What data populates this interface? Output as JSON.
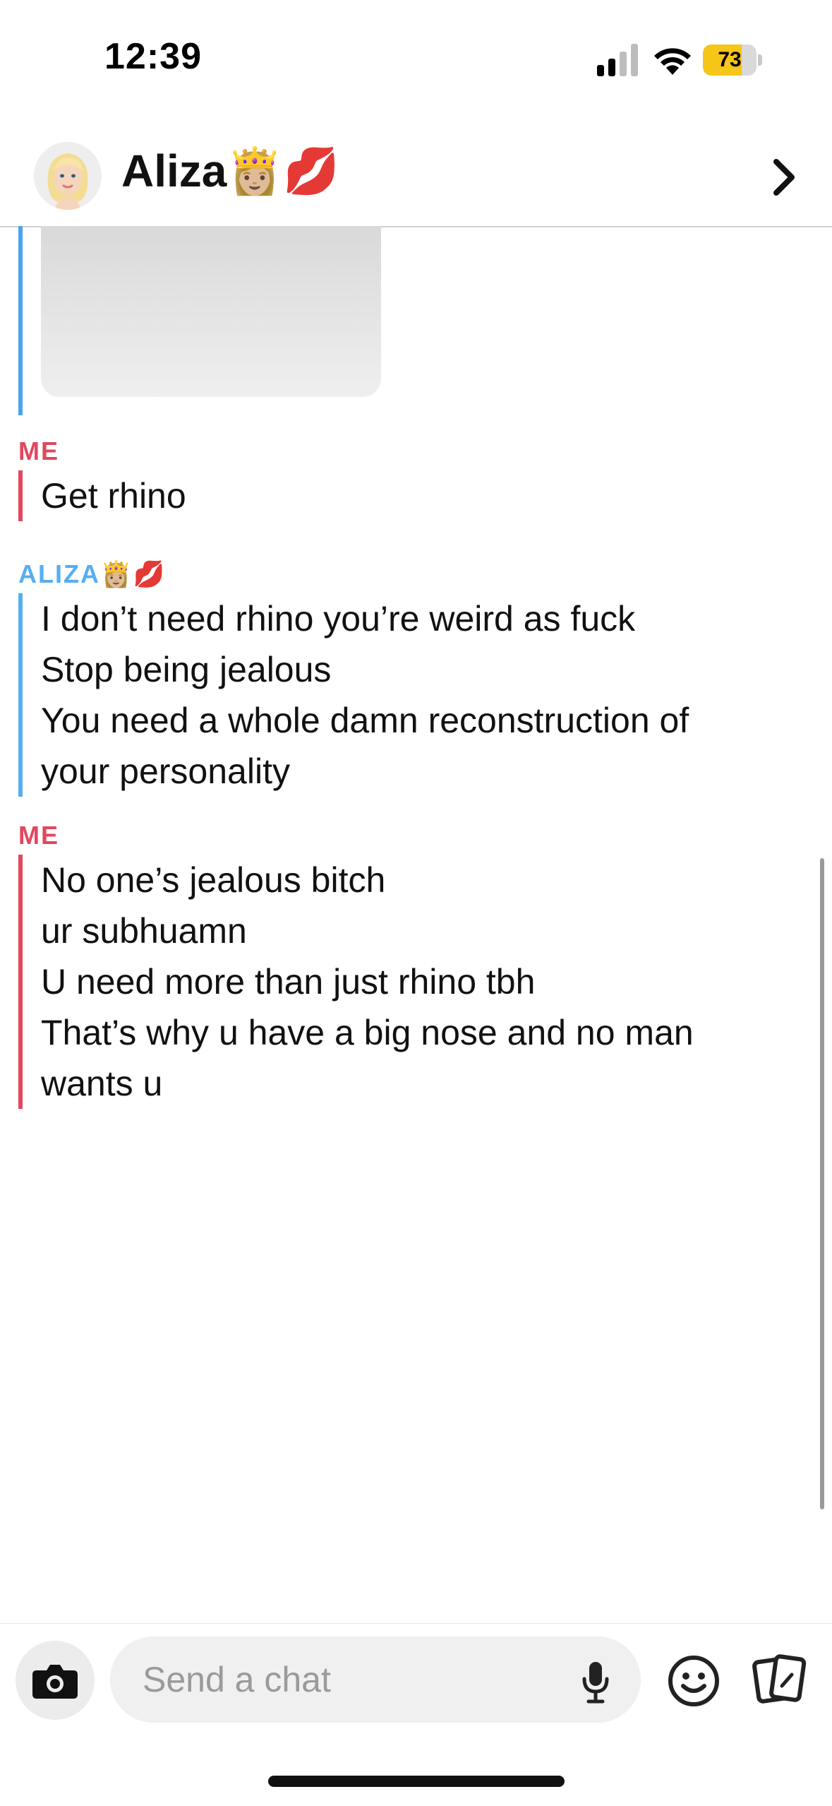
{
  "status_bar": {
    "time": "12:39",
    "battery_level": "73",
    "battery_fraction": 0.73
  },
  "header": {
    "contact_name": "Aliza👸🏼💋",
    "avatar_icon": "bitmoji-avatar-icon",
    "chevron_icon": "chevron-right-icon"
  },
  "thread": {
    "groups": [
      {
        "sender": "ME",
        "lines": [
          "Get rhino"
        ]
      },
      {
        "sender": "ALIZA👸🏼💋",
        "lines": [
          "I don’t need rhino you’re weird as fuck",
          "Stop being jealous",
          "You need a whole damn reconstruction of",
          "your personality"
        ]
      },
      {
        "sender": "ME",
        "lines": [
          "No one’s jealous bitch",
          "ur subhuamn",
          "U need more than just rhino tbh",
          "That’s why u have a big nose and no man",
          "wants u"
        ]
      }
    ]
  },
  "composer": {
    "placeholder": "Send a chat",
    "icons": [
      "camera-icon",
      "microphone-icon",
      "smiley-icon",
      "cards-icon"
    ]
  },
  "colors": {
    "me": "#e2475d",
    "friend": "#56aef2",
    "battery": "#f5c518"
  }
}
